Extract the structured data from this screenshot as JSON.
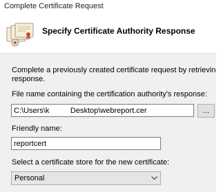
{
  "window": {
    "title": "Complete Certificate Request"
  },
  "header": {
    "title": "Specify Certificate Authority Response",
    "icon": "certificate-stack-icon"
  },
  "form": {
    "description_line1": "Complete a previously created certificate request by retrieving the file t",
    "description_line2": "response.",
    "file_label": "File name containing the certification authority's response:",
    "file_value": "C:\\Users\\k          Desktop\\webreport.cer",
    "browse_label": "...",
    "friendly_label": "Friendly name:",
    "friendly_value": "reportcert",
    "store_label": "Select a certificate store for the new certificate:",
    "store_selected": "Personal"
  },
  "colors": {
    "body_background": "#f0f0f0",
    "header_background": "#ffffff",
    "input_border": "#7a7a7a",
    "button_background": "#e1e1e1"
  }
}
